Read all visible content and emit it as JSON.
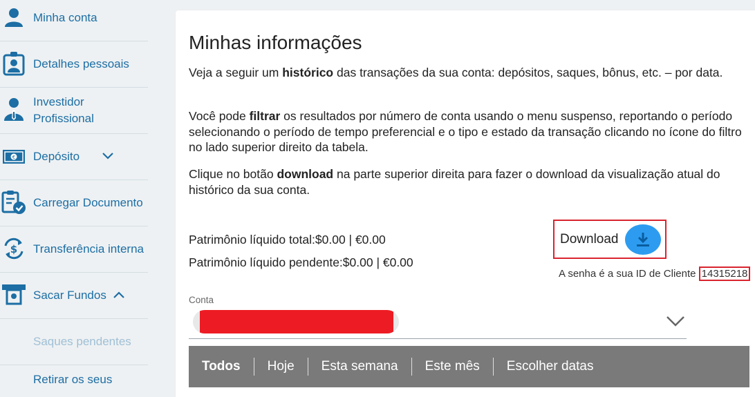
{
  "sidebar": {
    "items": [
      {
        "label": "Minha conta",
        "icon": "user-icon"
      },
      {
        "label": "Detalhes pessoais",
        "icon": "id-badge-icon"
      },
      {
        "label": "Investidor\nProfissional",
        "icon": "professional-investor-icon"
      },
      {
        "label": "Depósito",
        "icon": "banknote-icon",
        "chevron": "down"
      },
      {
        "label": "Carregar Documento",
        "icon": "document-check-icon"
      },
      {
        "label": "Transferência interna",
        "icon": "dollar-transfer-icon"
      },
      {
        "label": "Sacar Fundos",
        "icon": "atm-withdraw-icon",
        "chevron": "up"
      },
      {
        "label": "Saques pendentes"
      },
      {
        "label": "Retirar os seus"
      }
    ]
  },
  "main": {
    "title": "Minhas informações",
    "p1": {
      "before": "Veja a seguir um ",
      "bold": "histórico",
      "after": " das transações da sua conta: depósitos, saques, bônus, etc. – por data."
    },
    "p2": {
      "before": "Você pode ",
      "bold": "filtrar",
      "after": " os resultados por número de conta usando o menu suspenso, reportando o período selecionando o período de tempo preferencial e o tipo e estado da transação clicando no ícone do filtro no lado superior direito da tabela."
    },
    "p3": {
      "before": "Clique no botão ",
      "bold": "download",
      "after": " na parte superior direita para fazer o download da visualização atual do histórico da sua conta."
    },
    "equity_total": "Patrimônio líquido total:$0.00 | €0.00",
    "equity_pending": "Patrimônio líquido pendente:$0.00 | €0.00",
    "download_label": "Download",
    "password_note": "A senha é a sua ID de Cliente ",
    "client_id": "14315218",
    "conta_label": "Conta",
    "filters": [
      "Todos",
      "Hoje",
      "Esta semana",
      "Este mês",
      "Escolher datas"
    ],
    "active_filter": "Todos"
  },
  "colors": {
    "accent_blue": "#1c6ea4",
    "download_button": "#2d9cf0",
    "highlight_red": "#d9232e",
    "filter_bar": "#7a7a7a"
  }
}
